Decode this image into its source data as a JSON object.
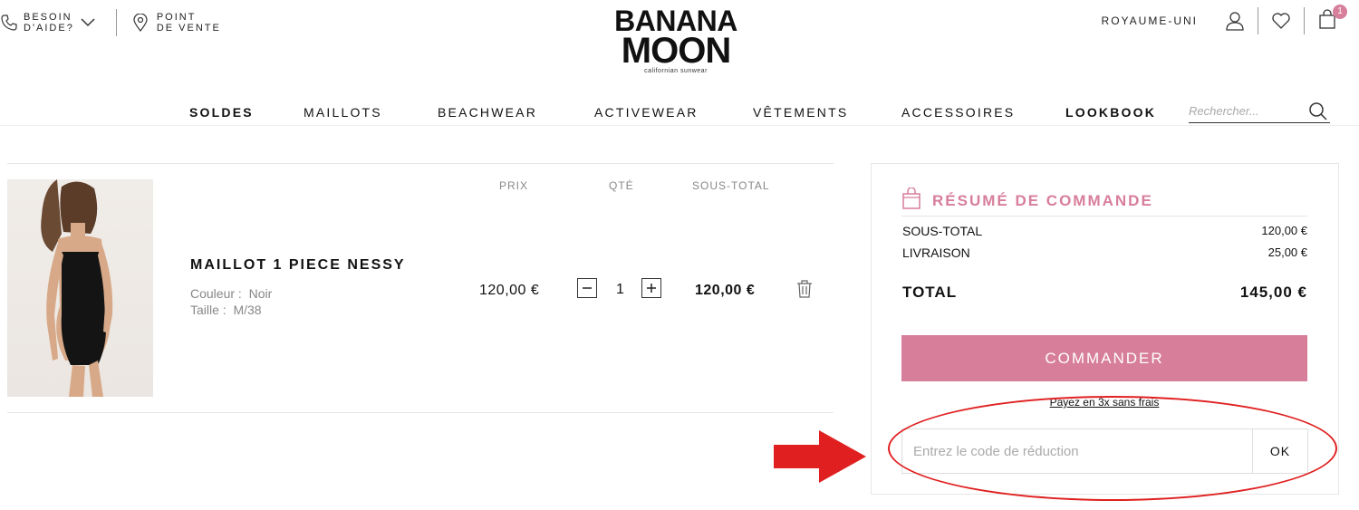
{
  "header": {
    "help_label_1": "BESOIN",
    "help_label_2": "D'AIDE?",
    "store_label_1": "POINT",
    "store_label_2": "DE VENTE",
    "logo_line_1": "BANANA",
    "logo_line_2": "MOON",
    "logo_tagline": "californian sunwear",
    "country": "ROYAUME-UNI",
    "cart_count": "1"
  },
  "nav": {
    "items": [
      "SOLDES",
      "MAILLOTS",
      "BEACHWEAR",
      "ACTIVEWEAR",
      "VÊTEMENTS",
      "ACCESSOIRES",
      "LOOKBOOK"
    ],
    "search_placeholder": "Rechercher..."
  },
  "cart": {
    "columns": {
      "price": "PRIX",
      "qty": "QTÉ",
      "subtotal": "SOUS-TOTAL"
    },
    "product": {
      "name": "MAILLOT 1 PIECE NESSY",
      "color_label": "Couleur :",
      "color_value": "Noir",
      "size_label": "Taille :",
      "size_value": "M/38",
      "price": "120,00 €",
      "qty": "1",
      "subtotal": "120,00 €"
    }
  },
  "summary": {
    "title": "RÉSUMÉ DE COMMANDE",
    "subtotal_label": "SOUS-TOTAL",
    "subtotal_value": "120,00 €",
    "shipping_label": "LIVRAISON",
    "shipping_value": "25,00 €",
    "total_label": "TOTAL",
    "total_value": "145,00 €",
    "checkout_button": "COMMANDER",
    "pay_in_3": "Payez en 3x sans frais",
    "promo_placeholder": "Entrez le code de réduction",
    "promo_button": "OK"
  },
  "colors": {
    "accent": "#d77e9a",
    "annotation_red": "#e02020"
  }
}
